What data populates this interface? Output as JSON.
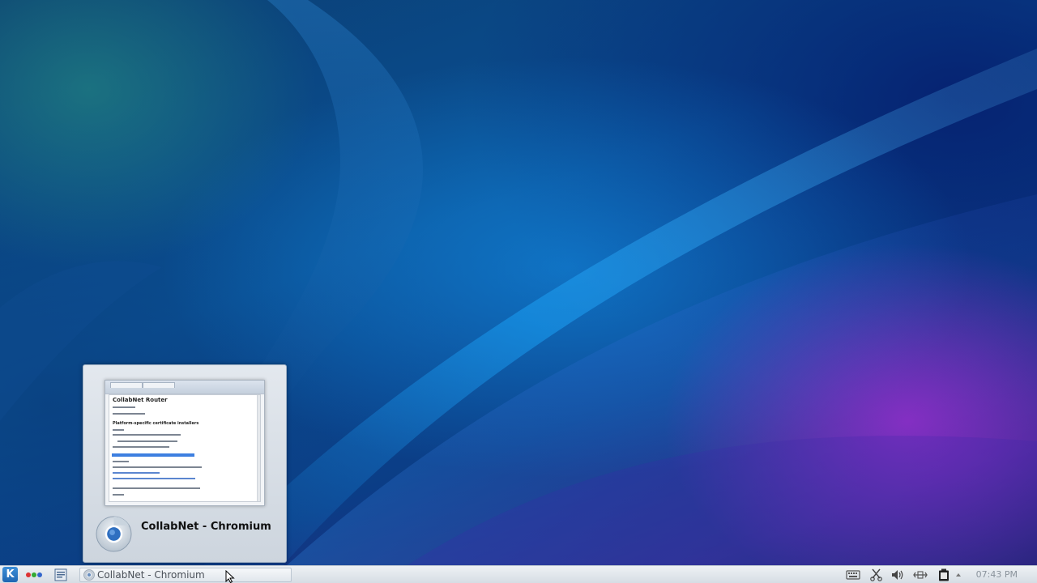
{
  "preview": {
    "window_title": "CollabNet - Chromium",
    "thumbnail": {
      "heading": "CollabNet Router",
      "subheading": "Platform-specific certificate installers"
    }
  },
  "taskbar": {
    "launcher_icon": "kde-kickoff-icon",
    "activities_icon": "activities-icon",
    "pager_icon": "pager-icon",
    "tasks": [
      {
        "label": "CollabNet - Chromium",
        "icon": "chromium-icon"
      }
    ],
    "tray_icons": [
      "keyboard-icon",
      "klipper-icon",
      "volume-icon",
      "network-icon",
      "battery-icon",
      "expand-tray-icon"
    ],
    "clock": "07:43 PM"
  },
  "colors": {
    "kde_blue": "#1f67b3",
    "wallpaper_dark": "#0b3f73",
    "wallpaper_magenta": "#be1ed2"
  }
}
